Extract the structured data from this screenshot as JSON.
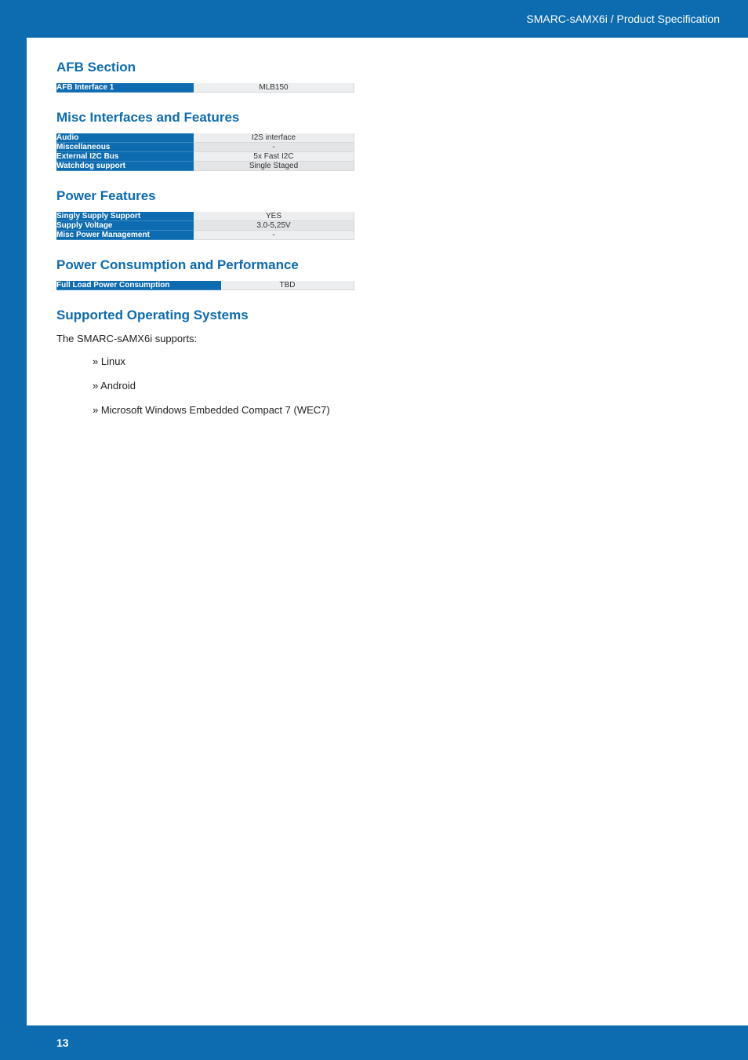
{
  "header": {
    "breadcrumb": "SMARC-sAMX6i / Product Specification"
  },
  "sections": {
    "afb": {
      "heading": "AFB Section",
      "rows": {
        "interface1": {
          "label": "AFB Interface 1",
          "value": "MLB150"
        }
      }
    },
    "misc": {
      "heading": "Misc Interfaces and Features",
      "rows": {
        "audio": {
          "label": "Audio",
          "value": "I2S interface"
        },
        "miscl": {
          "label": "Miscellaneous",
          "value": "-"
        },
        "i2c": {
          "label": "External I2C Bus",
          "value": "5x Fast I2C"
        },
        "watchdog": {
          "label": "Watchdog support",
          "value": "Single Staged"
        }
      }
    },
    "power": {
      "heading": "Power Features",
      "rows": {
        "singly": {
          "label": "Singly Supply Support",
          "value": "YES"
        },
        "voltage": {
          "label": "Supply Voltage",
          "value": "3.0-5,25V"
        },
        "mgmt": {
          "label": "Misc Power Management",
          "value": "-"
        }
      }
    },
    "consumption": {
      "heading": "Power Consumption and Performance",
      "rows": {
        "full": {
          "label": "Full Load Power Consumption",
          "value": "TBD"
        }
      }
    },
    "os": {
      "heading": "Supported Operating Systems",
      "intro": "The SMARC-sAMX6i supports:",
      "items": {
        "linux": "» Linux",
        "android": "» Android",
        "wec7": "» Microsoft Windows Embedded Compact 7 (WEC7)"
      }
    }
  },
  "footer": {
    "page": "13"
  }
}
